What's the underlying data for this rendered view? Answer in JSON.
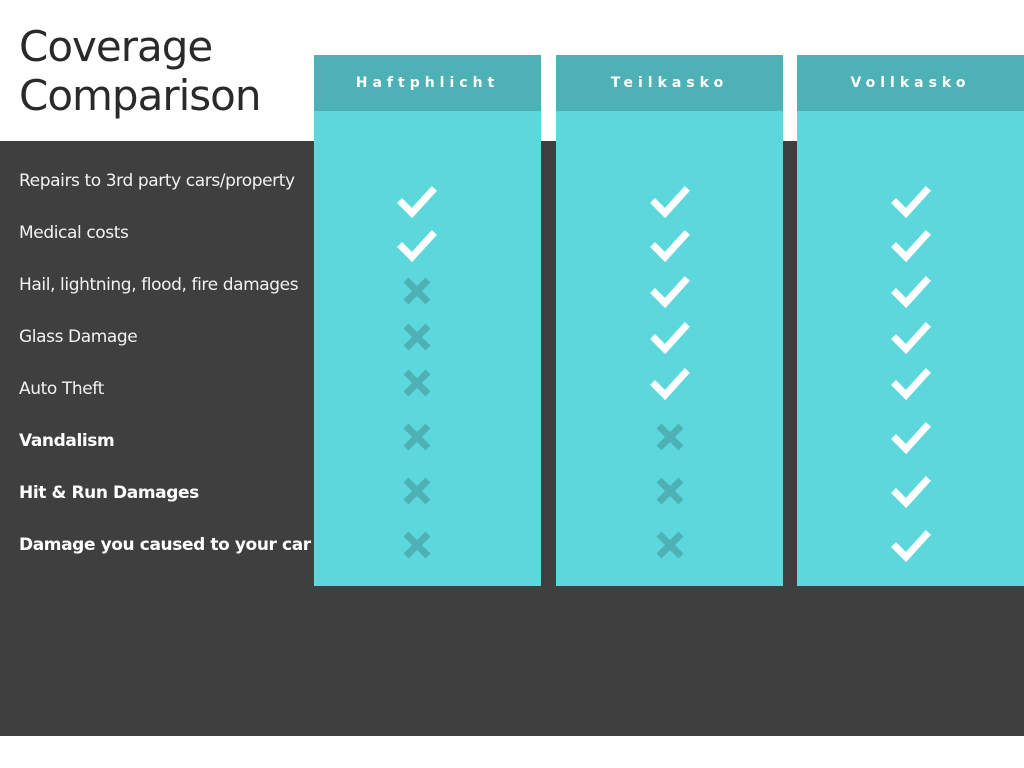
{
  "title": {
    "line1": "Coverage",
    "line2": "Comparison"
  },
  "features": [
    {
      "label": "Repairs to 3rd party cars/property",
      "bold": false
    },
    {
      "label": "Medical costs",
      "bold": false
    },
    {
      "label": "Hail, lightning, flood, fire damages",
      "bold": false
    },
    {
      "label": "Glass Damage",
      "bold": false
    },
    {
      "label": "Auto Theft",
      "bold": false
    },
    {
      "label": "Vandalism",
      "bold": true
    },
    {
      "label": "Hit & Run Damages",
      "bold": true
    },
    {
      "label": "Damage you caused to your car",
      "bold": true
    }
  ],
  "plans": [
    {
      "name": "Haftphlicht",
      "coverage": [
        true,
        true,
        false,
        false,
        false,
        false,
        false,
        false
      ]
    },
    {
      "name": "Teilkasko",
      "coverage": [
        true,
        true,
        true,
        true,
        true,
        false,
        false,
        false
      ]
    },
    {
      "name": "Vollkasko",
      "coverage": [
        true,
        true,
        true,
        true,
        true,
        true,
        true,
        true
      ]
    }
  ],
  "icons": {
    "included": "check-icon",
    "excluded": "cross-icon"
  },
  "colors": {
    "dark": "#3f3f3f",
    "card": "#5cd8dd",
    "card_header": "#4db1b5",
    "cross": "#4db1b5",
    "check": "#ffffff"
  }
}
